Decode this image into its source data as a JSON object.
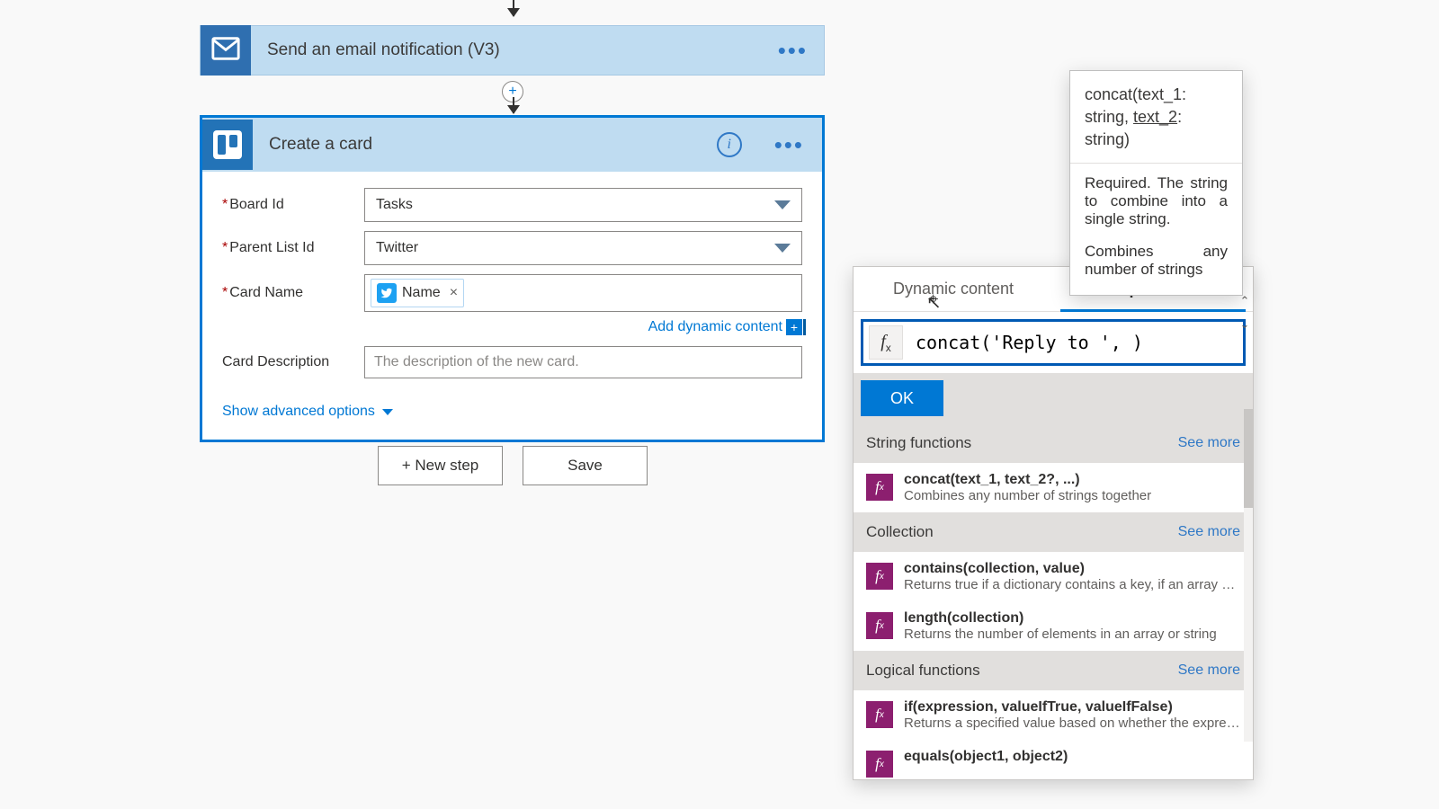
{
  "flow": {
    "emailStep": {
      "title": "Send an email notification (V3)"
    },
    "cardStep": {
      "title": "Create a card",
      "boardLabel": "Board Id",
      "boardValue": "Tasks",
      "parentLabel": "Parent List Id",
      "parentValue": "Twitter",
      "cardNameLabel": "Card Name",
      "tokenName": "Name",
      "addDynamic": "Add dynamic content",
      "descLabel": "Card Description",
      "descPlaceholder": "The description of the new card.",
      "advancedLabel": "Show advanced options"
    },
    "newStep": "+ New step",
    "save": "Save"
  },
  "dc": {
    "tabs": {
      "dynamic": "Dynamic content",
      "expression": "Expression"
    },
    "fx": "fx",
    "exprValue": "concat('Reply to ', )",
    "ok": "OK",
    "sections": {
      "string": "String functions",
      "collection": "Collection",
      "logical": "Logical functions"
    },
    "seeMore": "See more",
    "items": {
      "concat": {
        "sig": "concat(text_1, text_2?, ...)",
        "desc": "Combines any number of strings together"
      },
      "contains": {
        "sig": "contains(collection, value)",
        "desc": "Returns true if a dictionary contains a key, if an array cont..."
      },
      "length": {
        "sig": "length(collection)",
        "desc": "Returns the number of elements in an array or string"
      },
      "if": {
        "sig": "if(expression, valueIfTrue, valueIfFalse)",
        "desc": "Returns a specified value based on whether the expressio..."
      },
      "equals": {
        "sig": "equals(object1, object2)"
      }
    }
  },
  "tooltip": {
    "sig1": "concat(text_1:",
    "sig2a": "string, ",
    "sig2b": "text_2",
    "sig2c": ":",
    "sig3": "string)",
    "required": "Required. The string to combine into a single string.",
    "combines": "Combines any number of strings"
  }
}
